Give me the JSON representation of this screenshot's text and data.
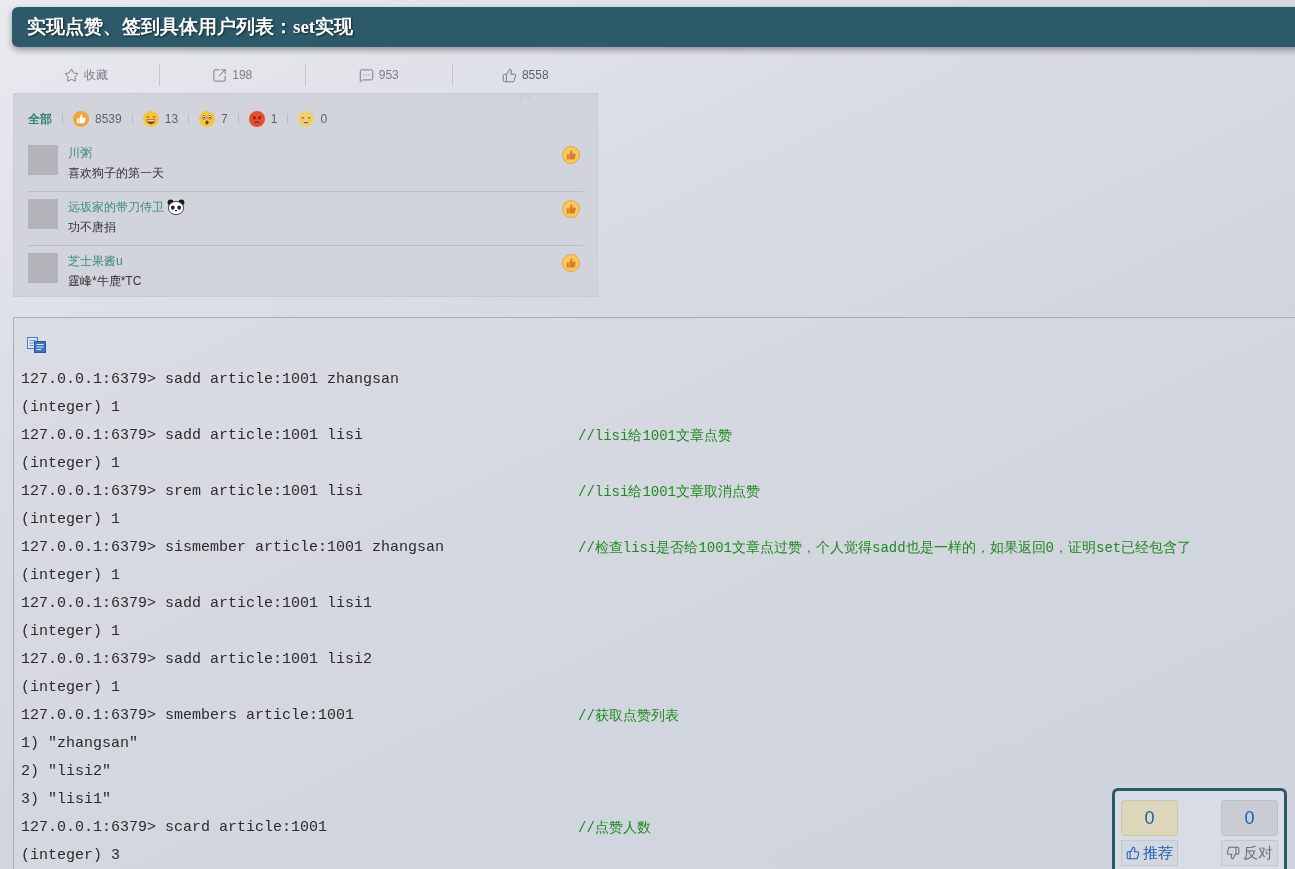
{
  "header": {
    "title": "实现点赞、签到具体用户列表：set实现"
  },
  "weibo_card": {
    "toolbar": [
      {
        "kind": "favorite",
        "label": "收藏",
        "selected": false
      },
      {
        "kind": "repost",
        "label": "198",
        "selected": false
      },
      {
        "kind": "comment",
        "label": "953",
        "selected": false
      },
      {
        "kind": "like",
        "label": "8558",
        "selected": true
      }
    ],
    "reactions": [
      {
        "kind": "all",
        "label": "全部",
        "selected": true
      },
      {
        "kind": "like",
        "label": "8539",
        "selected": false
      },
      {
        "kind": "laugh",
        "label": "13",
        "selected": false
      },
      {
        "kind": "surprise",
        "label": "7",
        "selected": false
      },
      {
        "kind": "angry",
        "label": "1",
        "selected": false
      },
      {
        "kind": "sad",
        "label": "0",
        "selected": false
      }
    ],
    "comments": [
      {
        "name": "川粥",
        "text": "喜欢狗子的第一天",
        "panda_badge": false
      },
      {
        "name": "远坂家的带刀侍卫",
        "text": "功不唐捐",
        "panda_badge": true
      },
      {
        "name": "芝士果酱u",
        "text": "霆峰*牛鹿*TC",
        "panda_badge": false
      }
    ]
  },
  "code_block": {
    "lines": [
      {
        "text": "127.0.0.1:6379> sadd article:1001 zhangsan"
      },
      {
        "text": "(integer) 1"
      },
      {
        "text": "127.0.0.1:6379> sadd article:1001 lisi",
        "comment": "//lisi给1001文章点赞"
      },
      {
        "text": "(integer) 1"
      },
      {
        "text": "127.0.0.1:6379> srem article:1001 lisi",
        "comment": "//lisi给1001文章取消点赞"
      },
      {
        "text": "(integer) 1"
      },
      {
        "text": "127.0.0.1:6379> sismember article:1001 zhangsan",
        "comment": "//检查lisi是否给1001文章点过赞，个人觉得sadd也是一样的，如果返回0，证明set已经包含了"
      },
      {
        "text": "(integer) 1"
      },
      {
        "text": "127.0.0.1:6379> sadd article:1001 lisi1"
      },
      {
        "text": "(integer) 1"
      },
      {
        "text": "127.0.0.1:6379> sadd article:1001 lisi2"
      },
      {
        "text": "(integer) 1"
      },
      {
        "text": "127.0.0.1:6379> smembers article:1001",
        "comment": "//获取点赞列表"
      },
      {
        "text": "1) \"zhangsan\""
      },
      {
        "text": "2) \"lisi2\""
      },
      {
        "text": "3) \"lisi1\""
      },
      {
        "text": "127.0.0.1:6379> scard article:1001",
        "comment": "//点赞人数"
      },
      {
        "text": "(integer) 3"
      }
    ]
  },
  "vote_box": {
    "items": [
      {
        "kind": "recommend",
        "count": "0",
        "label": "推荐"
      },
      {
        "kind": "oppose",
        "count": "0",
        "label": "反对"
      }
    ]
  }
}
